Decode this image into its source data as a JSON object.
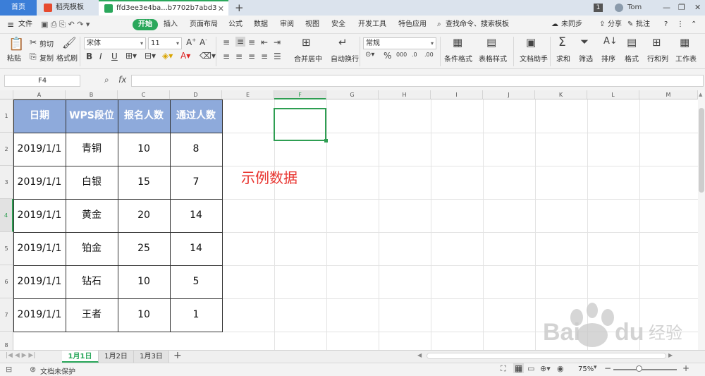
{
  "tabs": {
    "home": "首页",
    "template": "稻壳模板",
    "doc": "ffd3ee3e4ba...b7702b7abd3"
  },
  "window": {
    "badge": "1",
    "user": "Tom"
  },
  "menu": {
    "file": "文件",
    "start": "开始",
    "items": [
      "插入",
      "页面布局",
      "公式",
      "数据",
      "审阅",
      "视图",
      "安全",
      "开发工具",
      "特色应用"
    ],
    "search": "查找命令、搜索模板",
    "sync": "未同步",
    "share": "分享",
    "comment": "批注"
  },
  "toolbar": {
    "paste": "粘贴",
    "cut": "剪切",
    "copy": "复制",
    "format_painter": "格式刷",
    "font_name": "宋体",
    "font_size": "11",
    "merge_center": "合并居中",
    "wrap_text": "自动换行",
    "number_format": "常规",
    "conditional_format": "条件格式",
    "table_style": "表格样式",
    "doc_assistant": "文档助手",
    "sum": "求和",
    "filter": "筛选",
    "sort": "排序",
    "format": "格式",
    "rows_cols": "行和列",
    "worksheet": "工作表"
  },
  "formula_bar": {
    "name_box": "F4",
    "fx": "fx",
    "value": ""
  },
  "columns": [
    "A",
    "B",
    "C",
    "D",
    "E",
    "F",
    "G",
    "H",
    "I",
    "J",
    "K",
    "L",
    "M"
  ],
  "rows": [
    "1",
    "2",
    "3",
    "4",
    "5",
    "6",
    "7",
    "8"
  ],
  "table": {
    "headers": [
      "日期",
      "WPS段位",
      "报名人数",
      "通过人数"
    ],
    "rows": [
      [
        "2019/1/1",
        "青铜",
        "10",
        "8"
      ],
      [
        "2019/1/1",
        "白银",
        "15",
        "7"
      ],
      [
        "2019/1/1",
        "黄金",
        "20",
        "14"
      ],
      [
        "2019/1/1",
        "铂金",
        "25",
        "14"
      ],
      [
        "2019/1/1",
        "钻石",
        "10",
        "5"
      ],
      [
        "2019/1/1",
        "王者",
        "10",
        "1"
      ]
    ]
  },
  "annotation": "示例数据",
  "sheets": [
    "1月1日",
    "1月2日",
    "1月3日"
  ],
  "status": {
    "protect": "文档未保护",
    "zoom": "75%"
  },
  "watermark": {
    "url": "jingyan.baidu.com"
  },
  "colors": {
    "accent_green": "#2aa75b",
    "header_fill": "#8eaadb",
    "annotation_red": "#e8332e",
    "home_tab_blue": "#3b7ed8"
  }
}
